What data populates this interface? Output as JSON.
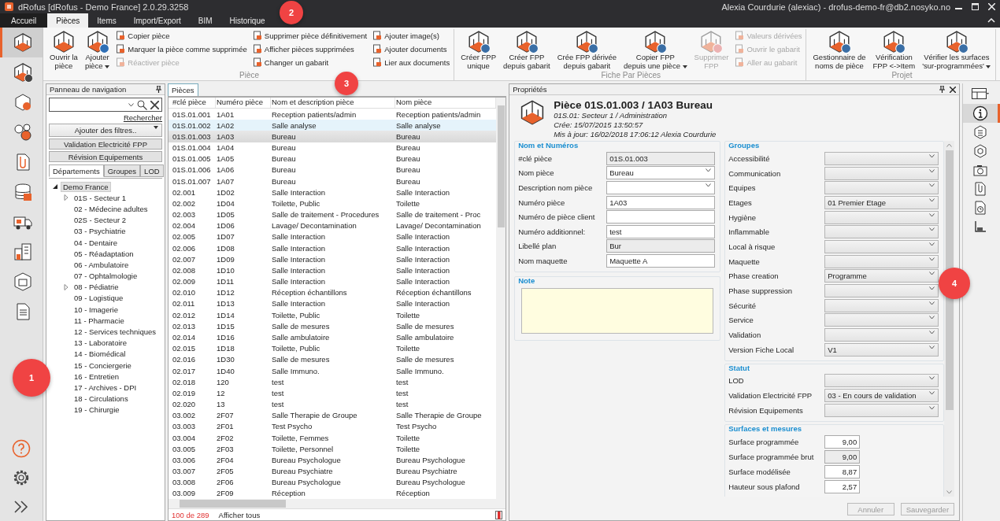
{
  "window": {
    "title": "dRofus [dRofus - Demo France] 2.0.29.3258",
    "user": "Alexia Courdurie (alexiac) - drofus-demo-fr@db2.nosyko.no"
  },
  "menu_tabs": [
    {
      "label": "Accueil",
      "selected": false
    },
    {
      "label": "Pièces",
      "selected": true
    },
    {
      "label": "Items",
      "selected": false
    },
    {
      "label": "Import/Export",
      "selected": false
    },
    {
      "label": "BIM",
      "selected": false
    },
    {
      "label": "Historique",
      "selected": false
    }
  ],
  "ribbon": [
    {
      "label": "Pièce",
      "items": [
        {
          "kind": "large",
          "label": "Ouvrir la\npièce",
          "disabled": false,
          "has_menu": false
        },
        {
          "kind": "large",
          "label": "Ajouter\npièce",
          "disabled": false,
          "has_menu": true
        },
        {
          "kind": "stack",
          "buttons": [
            {
              "label": "Copier pièce",
              "disabled": false
            },
            {
              "label": "Marquer la pièce comme supprimée",
              "disabled": false
            },
            {
              "label": "Réactiver pièce",
              "disabled": true
            }
          ]
        },
        {
          "kind": "stack",
          "buttons": [
            {
              "label": "Supprimer pièce définitivement",
              "disabled": false
            },
            {
              "label": "Afficher pièces supprimées",
              "disabled": false
            },
            {
              "label": "Changer un gabarit",
              "disabled": false
            }
          ]
        },
        {
          "kind": "stack",
          "buttons": [
            {
              "label": "Ajouter image(s)",
              "disabled": false
            },
            {
              "label": "Ajouter documents",
              "disabled": false
            },
            {
              "label": "Lier aux documents",
              "disabled": false
            }
          ]
        }
      ]
    },
    {
      "label": "Fiche Par Pièces",
      "items": [
        {
          "kind": "large",
          "label": "Créer FPP\nunique",
          "disabled": false,
          "has_menu": false
        },
        {
          "kind": "large",
          "label": "Créer FPP\ndepuis gabarit",
          "disabled": false,
          "has_menu": false
        },
        {
          "kind": "large",
          "label": "Crée FPP dérivée\ndepuis gabarit",
          "disabled": false,
          "has_menu": false
        },
        {
          "kind": "large",
          "label": "Copier FPP\ndepuis une pièce",
          "disabled": false,
          "has_menu": true
        },
        {
          "kind": "large",
          "label": "Supprimer\nFPP",
          "disabled": true,
          "has_menu": false
        },
        {
          "kind": "stack",
          "buttons": [
            {
              "label": "Valeurs dérivées",
              "disabled": true
            },
            {
              "label": "Ouvrir le gabarit",
              "disabled": true
            },
            {
              "label": "Aller au gabarit",
              "disabled": true
            }
          ]
        }
      ]
    },
    {
      "label": "Projet",
      "items": [
        {
          "kind": "large",
          "label": "Gestionnaire de\nnoms de pièce",
          "disabled": false,
          "has_menu": false
        },
        {
          "kind": "large",
          "label": "Vérification\nFPP <->Item",
          "disabled": false,
          "has_menu": false
        },
        {
          "kind": "large",
          "label": "Vérifier les surfaces\n'sur-programmées'",
          "disabled": false,
          "has_menu": true
        }
      ]
    }
  ],
  "sidebar": [
    {
      "selected": true
    },
    {
      "selected": false
    },
    {
      "selected": false
    },
    {
      "selected": false
    },
    {
      "selected": false
    },
    {
      "selected": false
    },
    {
      "selected": false
    },
    {
      "selected": false
    },
    {
      "selected": false
    },
    {
      "selected": false
    }
  ],
  "navigation": {
    "title": "Panneau de navigation",
    "search_button": "Rechercher",
    "filter": "Ajouter des filtres..",
    "filter_buttons": [
      "Validation Electricité FPP",
      "Révision Equipements"
    ],
    "tabs": [
      {
        "label": "Départements",
        "selected": true
      },
      {
        "label": "Groupes",
        "selected": false
      },
      {
        "label": "LOD",
        "selected": false
      }
    ],
    "tree": [
      {
        "label": "Demo France",
        "selected": true,
        "expanded": true,
        "children": [
          {
            "label": "01S - Secteur 1",
            "selected": false,
            "expanded": false
          },
          {
            "label": "02 - Médecine adultes",
            "selected": false
          },
          {
            "label": "02S - Secteur 2",
            "selected": false
          },
          {
            "label": "03 - Psychiatrie",
            "selected": false
          },
          {
            "label": "04 - Dentaire",
            "selected": false
          },
          {
            "label": "05 - Réadaptation",
            "selected": false
          },
          {
            "label": "06 - Ambulatoire",
            "selected": false
          },
          {
            "label": "07 - Ophtalmologie",
            "selected": false
          },
          {
            "label": "08 - Pédiatrie",
            "selected": false,
            "expanded": false
          },
          {
            "label": "09 - Logistique",
            "selected": false
          },
          {
            "label": "10 - Imagerie",
            "selected": false
          },
          {
            "label": "11 - Pharmacie",
            "selected": false
          },
          {
            "label": "12 - Services techniques",
            "selected": false
          },
          {
            "label": "13 - Laboratoire",
            "selected": false
          },
          {
            "label": "14 - Biomédical",
            "selected": false
          },
          {
            "label": "15 - Conciergerie",
            "selected": false
          },
          {
            "label": "16 - Entretien",
            "selected": false
          },
          {
            "label": "17 - Archives - DPI",
            "selected": false
          },
          {
            "label": "18 - Circulations",
            "selected": false
          },
          {
            "label": "19 - Chirurgie",
            "selected": false
          }
        ]
      }
    ]
  },
  "table": {
    "tab": "Pièces",
    "columns": [
      "#clé pièce",
      "Numéro pièce",
      "Nom et description pièce",
      "Nom pièce"
    ],
    "rows": [
      {
        "cells": [
          "01S.01.001",
          "1A01",
          "Reception patients/admin",
          "Reception patients/admin"
        ],
        "selected": false,
        "hovered": false
      },
      {
        "cells": [
          "01S.01.002",
          "1A02",
          "Salle analyse",
          "Salle analyse"
        ],
        "selected": false,
        "hovered": true
      },
      {
        "cells": [
          "01S.01.003",
          "1A03",
          "Bureau",
          "Bureau"
        ],
        "selected": true,
        "hovered": false
      },
      {
        "cells": [
          "01S.01.004",
          "1A04",
          "Bureau",
          "Bureau"
        ],
        "selected": false,
        "hovered": false
      },
      {
        "cells": [
          "01S.01.005",
          "1A05",
          "Bureau",
          "Bureau"
        ],
        "selected": false,
        "hovered": false
      },
      {
        "cells": [
          "01S.01.006",
          "1A06",
          "Bureau",
          "Bureau"
        ],
        "selected": false,
        "hovered": false
      },
      {
        "cells": [
          "01S.01.007",
          "1A07",
          "Bureau",
          "Bureau"
        ],
        "selected": false,
        "hovered": false
      },
      {
        "cells": [
          "02.001",
          "1D02",
          "Salle Interaction",
          "Salle Interaction"
        ],
        "selected": false,
        "hovered": false
      },
      {
        "cells": [
          "02.002",
          "1D04",
          "Toilette, Public",
          "Toilette"
        ],
        "selected": false,
        "hovered": false
      },
      {
        "cells": [
          "02.003",
          "1D05",
          "Salle de traitement - Procedures",
          "Salle de traitement - Proc"
        ],
        "selected": false,
        "hovered": false
      },
      {
        "cells": [
          "02.004",
          "1D06",
          "Lavage/ Decontamination",
          "Lavage/ Decontamination"
        ],
        "selected": false,
        "hovered": false
      },
      {
        "cells": [
          "02.005",
          "1D07",
          "Salle Interaction",
          "Salle Interaction"
        ],
        "selected": false,
        "hovered": false
      },
      {
        "cells": [
          "02.006",
          "1D08",
          "Salle Interaction",
          "Salle Interaction"
        ],
        "selected": false,
        "hovered": false
      },
      {
        "cells": [
          "02.007",
          "1D09",
          "Salle Interaction",
          "Salle Interaction"
        ],
        "selected": false,
        "hovered": false
      },
      {
        "cells": [
          "02.008",
          "1D10",
          "Salle Interaction",
          "Salle Interaction"
        ],
        "selected": false,
        "hovered": false
      },
      {
        "cells": [
          "02.009",
          "1D11",
          "Salle Interaction",
          "Salle Interaction"
        ],
        "selected": false,
        "hovered": false
      },
      {
        "cells": [
          "02.010",
          "1D12",
          "Réception échantillons",
          "Réception échantillons"
        ],
        "selected": false,
        "hovered": false
      },
      {
        "cells": [
          "02.011",
          "1D13",
          "Salle Interaction",
          "Salle Interaction"
        ],
        "selected": false,
        "hovered": false
      },
      {
        "cells": [
          "02.012",
          "1D14",
          "Toilette, Public",
          "Toilette"
        ],
        "selected": false,
        "hovered": false
      },
      {
        "cells": [
          "02.013",
          "1D15",
          "Salle de mesures",
          "Salle de mesures"
        ],
        "selected": false,
        "hovered": false
      },
      {
        "cells": [
          "02.014",
          "1D16",
          "Salle ambulatoire",
          "Salle ambulatoire"
        ],
        "selected": false,
        "hovered": false
      },
      {
        "cells": [
          "02.015",
          "1D18",
          "Toilette, Public",
          "Toilette"
        ],
        "selected": false,
        "hovered": false
      },
      {
        "cells": [
          "02.016",
          "1D30",
          "Salle de mesures",
          "Salle de mesures"
        ],
        "selected": false,
        "hovered": false
      },
      {
        "cells": [
          "02.017",
          "1D40",
          "Salle Immuno.",
          "Salle Immuno."
        ],
        "selected": false,
        "hovered": false
      },
      {
        "cells": [
          "02.018",
          "120",
          "test",
          "test"
        ],
        "selected": false,
        "hovered": false
      },
      {
        "cells": [
          "02.019",
          "12",
          "test",
          "test"
        ],
        "selected": false,
        "hovered": false
      },
      {
        "cells": [
          "02.020",
          "13",
          "test",
          "test"
        ],
        "selected": false,
        "hovered": false
      },
      {
        "cells": [
          "03.002",
          "2F07",
          "Salle Therapie de Groupe",
          "Salle Therapie de Groupe"
        ],
        "selected": false,
        "hovered": false
      },
      {
        "cells": [
          "03.003",
          "2F01",
          "Test Psycho",
          "Test Psycho"
        ],
        "selected": false,
        "hovered": false
      },
      {
        "cells": [
          "03.004",
          "2F02",
          "Toilette, Femmes",
          "Toilette"
        ],
        "selected": false,
        "hovered": false
      },
      {
        "cells": [
          "03.005",
          "2F03",
          "Toilette, Personnel",
          "Toilette"
        ],
        "selected": false,
        "hovered": false
      },
      {
        "cells": [
          "03.006",
          "2F04",
          "Bureau Psychologue",
          "Bureau Psychologue"
        ],
        "selected": false,
        "hovered": false
      },
      {
        "cells": [
          "03.007",
          "2F05",
          "Bureau Psychiatre",
          "Bureau Psychiatre"
        ],
        "selected": false,
        "hovered": false
      },
      {
        "cells": [
          "03.008",
          "2F06",
          "Bureau Psychologue",
          "Bureau Psychologue"
        ],
        "selected": false,
        "hovered": false
      },
      {
        "cells": [
          "03.009",
          "2F09",
          "Réception",
          "Réception"
        ],
        "selected": false,
        "hovered": false
      }
    ],
    "count": "100 de 289",
    "show_all": "Afficher tous"
  },
  "properties": {
    "title": "Propriétés",
    "heading": "Pièce 01S.01.003 / 1A03 Bureau",
    "details": [
      "01S.01: Secteur 1 / Administration",
      "Crée: 15/07/2015 13:50:57",
      "Mis à jour: 16/02/2018 17:06:12 Alexia Courdurie"
    ],
    "left_sections": [
      {
        "title": "Nom et Numéros",
        "fields": [
          {
            "label": "#clé pièce",
            "value": "01S.01.003",
            "kind": "readonly"
          },
          {
            "label": "Nom pièce",
            "value": "Bureau",
            "kind": "combo"
          },
          {
            "label": "Description nom pièce",
            "kind": "combo"
          },
          {
            "label": "Numéro pièce",
            "value": "1A03",
            "kind": "input"
          },
          {
            "label": "Numéro de pièce client",
            "kind": "input"
          },
          {
            "label": "Numéro additionnel:",
            "value": "test",
            "kind": "input"
          },
          {
            "label": "Libellé plan",
            "value": "Bur",
            "kind": "readonly"
          },
          {
            "label": "Nom maquette",
            "value": "Maquette A",
            "kind": "input"
          }
        ]
      },
      {
        "title": "Note",
        "kind": "note"
      }
    ],
    "right_sections": [
      {
        "title": "Groupes",
        "fields": [
          {
            "label": "Accessibilité",
            "kind": "dropdown"
          },
          {
            "label": "Communication",
            "kind": "dropdown"
          },
          {
            "label": "Equipes",
            "kind": "dropdown"
          },
          {
            "label": "Etages",
            "value": "01 Premier Etage",
            "kind": "dropdown"
          },
          {
            "label": "Hygiène",
            "kind": "dropdown"
          },
          {
            "label": "Inflammable",
            "kind": "dropdown"
          },
          {
            "label": "Local à risque",
            "kind": "dropdown"
          },
          {
            "label": "Maquette",
            "kind": "dropdown"
          },
          {
            "label": "Phase creation",
            "value": "Programme",
            "kind": "dropdown"
          },
          {
            "label": "Phase suppression",
            "kind": "dropdown"
          },
          {
            "label": "Sécurité",
            "kind": "dropdown"
          },
          {
            "label": "Service",
            "kind": "dropdown"
          },
          {
            "label": "Validation",
            "kind": "dropdown"
          },
          {
            "label": "Version Fiche Local",
            "value": "V1",
            "kind": "dropdown"
          }
        ]
      },
      {
        "title": "Statut",
        "fields": [
          {
            "label": "LOD",
            "kind": "dropdown"
          },
          {
            "label": "Validation Electricité FPP",
            "value": "03 - En cours de validation",
            "kind": "dropdown"
          },
          {
            "label": "Révision Equipements",
            "kind": "dropdown"
          }
        ]
      },
      {
        "title": "Surfaces et mesures",
        "fields": [
          {
            "label": "Surface programmée",
            "value": "9,00",
            "kind": "number"
          },
          {
            "label": "Surface programmée brut",
            "value": "9,00",
            "kind": "number_readonly"
          },
          {
            "label": "Surface modélisée",
            "value": "8,87",
            "kind": "number"
          },
          {
            "label": "Hauteur sous plafond",
            "value": "2,57",
            "kind": "number"
          }
        ]
      }
    ],
    "buttons": [
      {
        "label": "Annuler",
        "disabled": true
      },
      {
        "label": "Sauvegarder",
        "disabled": true
      }
    ]
  },
  "right_bar": [
    {
      "selected": false
    },
    {
      "selected": true
    },
    {
      "selected": false
    },
    {
      "selected": false
    },
    {
      "selected": false
    },
    {
      "selected": false
    },
    {
      "selected": false
    },
    {
      "selected": false
    }
  ],
  "callouts": [
    "1",
    "2",
    "3",
    "4"
  ]
}
